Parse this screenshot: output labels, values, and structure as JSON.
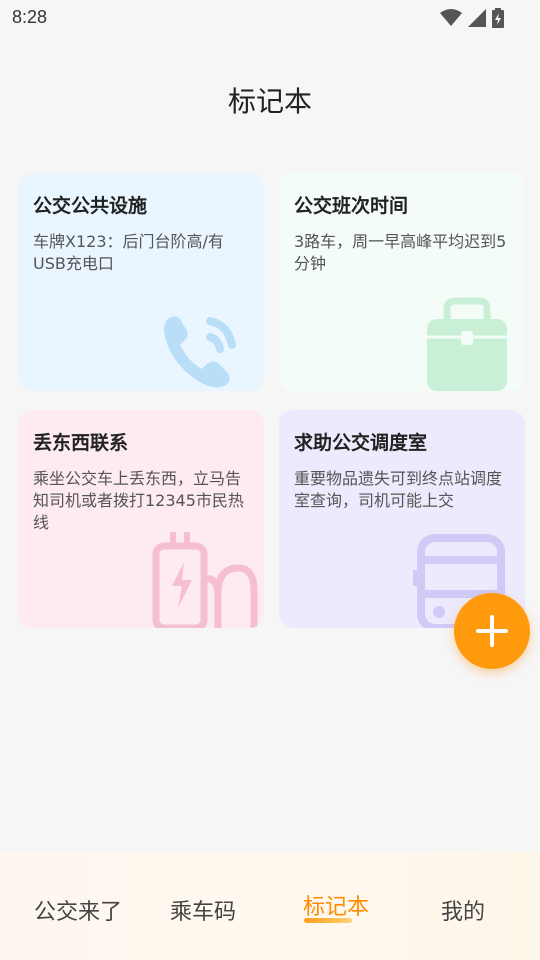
{
  "status_bar": {
    "time": "8:28"
  },
  "page": {
    "title": "标记本"
  },
  "cards": [
    {
      "title": "公交公共设施",
      "body": "车牌X123：后门台阶高/有USB充电口",
      "icon": "phone-icon"
    },
    {
      "title": "公交班次时间",
      "body": "3路车，周一早高峰平均迟到5分钟",
      "icon": "bag-icon"
    },
    {
      "title": "丢东西联系",
      "body": "乘坐公交车上丢东西，立马告知司机或者拨打12345市民热线",
      "icon": "charger-icon"
    },
    {
      "title": "求助公交调度室",
      "body": "重要物品遗失可到终点站调度室查询，司机可能上交",
      "icon": "bus-icon"
    }
  ],
  "fab": {
    "icon": "plus-icon"
  },
  "bottom_nav": {
    "items": [
      {
        "label": "公交来了"
      },
      {
        "label": "乘车码"
      },
      {
        "label": "标记本"
      },
      {
        "label": "我的"
      }
    ],
    "active_index": 2
  },
  "colors": {
    "accent": "#ff9a0d",
    "card_blue": "#e9f6ff",
    "card_green": "#f3fcf7",
    "card_pink": "#fdebf0",
    "card_purple": "#eceafd"
  }
}
